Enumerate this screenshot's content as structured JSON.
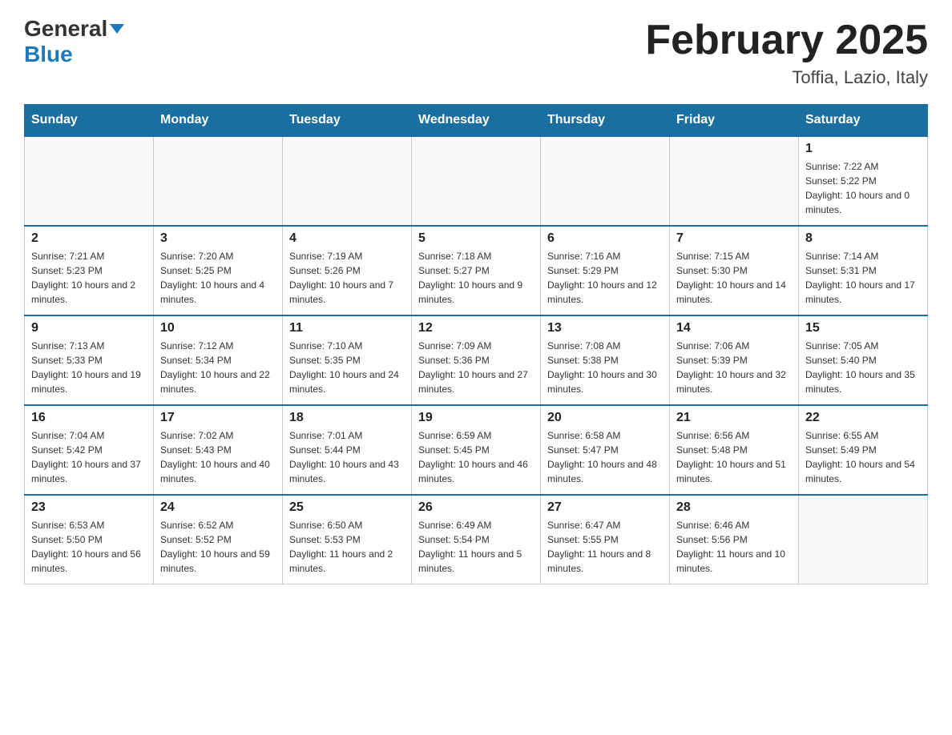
{
  "header": {
    "logo": {
      "general": "General",
      "blue": "Blue"
    },
    "title": "February 2025",
    "subtitle": "Toffia, Lazio, Italy"
  },
  "calendar": {
    "days_of_week": [
      "Sunday",
      "Monday",
      "Tuesday",
      "Wednesday",
      "Thursday",
      "Friday",
      "Saturday"
    ],
    "weeks": [
      [
        {
          "day": "",
          "info": ""
        },
        {
          "day": "",
          "info": ""
        },
        {
          "day": "",
          "info": ""
        },
        {
          "day": "",
          "info": ""
        },
        {
          "day": "",
          "info": ""
        },
        {
          "day": "",
          "info": ""
        },
        {
          "day": "1",
          "info": "Sunrise: 7:22 AM\nSunset: 5:22 PM\nDaylight: 10 hours and 0 minutes."
        }
      ],
      [
        {
          "day": "2",
          "info": "Sunrise: 7:21 AM\nSunset: 5:23 PM\nDaylight: 10 hours and 2 minutes."
        },
        {
          "day": "3",
          "info": "Sunrise: 7:20 AM\nSunset: 5:25 PM\nDaylight: 10 hours and 4 minutes."
        },
        {
          "day": "4",
          "info": "Sunrise: 7:19 AM\nSunset: 5:26 PM\nDaylight: 10 hours and 7 minutes."
        },
        {
          "day": "5",
          "info": "Sunrise: 7:18 AM\nSunset: 5:27 PM\nDaylight: 10 hours and 9 minutes."
        },
        {
          "day": "6",
          "info": "Sunrise: 7:16 AM\nSunset: 5:29 PM\nDaylight: 10 hours and 12 minutes."
        },
        {
          "day": "7",
          "info": "Sunrise: 7:15 AM\nSunset: 5:30 PM\nDaylight: 10 hours and 14 minutes."
        },
        {
          "day": "8",
          "info": "Sunrise: 7:14 AM\nSunset: 5:31 PM\nDaylight: 10 hours and 17 minutes."
        }
      ],
      [
        {
          "day": "9",
          "info": "Sunrise: 7:13 AM\nSunset: 5:33 PM\nDaylight: 10 hours and 19 minutes."
        },
        {
          "day": "10",
          "info": "Sunrise: 7:12 AM\nSunset: 5:34 PM\nDaylight: 10 hours and 22 minutes."
        },
        {
          "day": "11",
          "info": "Sunrise: 7:10 AM\nSunset: 5:35 PM\nDaylight: 10 hours and 24 minutes."
        },
        {
          "day": "12",
          "info": "Sunrise: 7:09 AM\nSunset: 5:36 PM\nDaylight: 10 hours and 27 minutes."
        },
        {
          "day": "13",
          "info": "Sunrise: 7:08 AM\nSunset: 5:38 PM\nDaylight: 10 hours and 30 minutes."
        },
        {
          "day": "14",
          "info": "Sunrise: 7:06 AM\nSunset: 5:39 PM\nDaylight: 10 hours and 32 minutes."
        },
        {
          "day": "15",
          "info": "Sunrise: 7:05 AM\nSunset: 5:40 PM\nDaylight: 10 hours and 35 minutes."
        }
      ],
      [
        {
          "day": "16",
          "info": "Sunrise: 7:04 AM\nSunset: 5:42 PM\nDaylight: 10 hours and 37 minutes."
        },
        {
          "day": "17",
          "info": "Sunrise: 7:02 AM\nSunset: 5:43 PM\nDaylight: 10 hours and 40 minutes."
        },
        {
          "day": "18",
          "info": "Sunrise: 7:01 AM\nSunset: 5:44 PM\nDaylight: 10 hours and 43 minutes."
        },
        {
          "day": "19",
          "info": "Sunrise: 6:59 AM\nSunset: 5:45 PM\nDaylight: 10 hours and 46 minutes."
        },
        {
          "day": "20",
          "info": "Sunrise: 6:58 AM\nSunset: 5:47 PM\nDaylight: 10 hours and 48 minutes."
        },
        {
          "day": "21",
          "info": "Sunrise: 6:56 AM\nSunset: 5:48 PM\nDaylight: 10 hours and 51 minutes."
        },
        {
          "day": "22",
          "info": "Sunrise: 6:55 AM\nSunset: 5:49 PM\nDaylight: 10 hours and 54 minutes."
        }
      ],
      [
        {
          "day": "23",
          "info": "Sunrise: 6:53 AM\nSunset: 5:50 PM\nDaylight: 10 hours and 56 minutes."
        },
        {
          "day": "24",
          "info": "Sunrise: 6:52 AM\nSunset: 5:52 PM\nDaylight: 10 hours and 59 minutes."
        },
        {
          "day": "25",
          "info": "Sunrise: 6:50 AM\nSunset: 5:53 PM\nDaylight: 11 hours and 2 minutes."
        },
        {
          "day": "26",
          "info": "Sunrise: 6:49 AM\nSunset: 5:54 PM\nDaylight: 11 hours and 5 minutes."
        },
        {
          "day": "27",
          "info": "Sunrise: 6:47 AM\nSunset: 5:55 PM\nDaylight: 11 hours and 8 minutes."
        },
        {
          "day": "28",
          "info": "Sunrise: 6:46 AM\nSunset: 5:56 PM\nDaylight: 11 hours and 10 minutes."
        },
        {
          "day": "",
          "info": ""
        }
      ]
    ]
  }
}
